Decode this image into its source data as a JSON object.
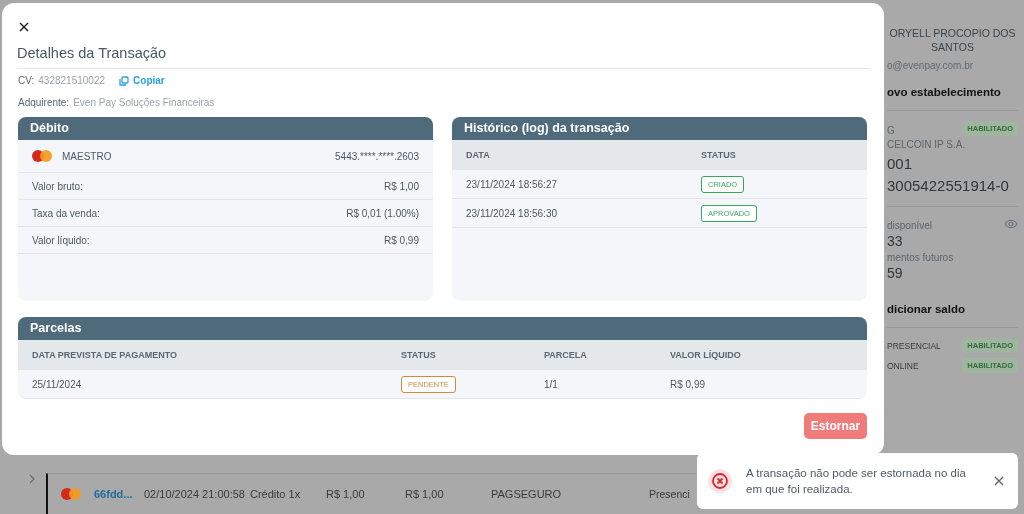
{
  "background_page": {
    "profile": {
      "name": "ORYELL PROCOPIO DOS SANTOS",
      "email": "o@evenpay.com.br",
      "new_store_link": "ovo estabelecimento",
      "account_label": "G",
      "account_badge": "HABILITADO",
      "bank": "CELCOIN IP S.A.",
      "agency": "001",
      "account_number": "3005422551914-0",
      "balance_label": "disponível",
      "balance_value": "33",
      "future_label": "mentos futuros",
      "future_value": "59",
      "add_balance_link": "dicionar saldo",
      "channels": [
        {
          "label": "PRESENCIAL",
          "badge": "HABILITADO"
        },
        {
          "label": "ONLINE",
          "badge": "HABILITADO"
        }
      ]
    },
    "table_row": {
      "id": "66fdd...",
      "date": "02/10/2024 21:00:58",
      "type": "Crédito 1x",
      "gross": "R$ 1,00",
      "net": "R$ 1,00",
      "acquirer": "PAGSEGURO",
      "channel": "Presenci"
    }
  },
  "modal": {
    "title": "Detalhes da Transação",
    "cv_label": "CV:",
    "cv_value": "432821510022",
    "copy_link": "Copiar",
    "acquirer_label": "Adquirente:",
    "acquirer_value": "Even Pay Soluções Financeiras",
    "debit": {
      "title": "Débito",
      "brand": "MAESTRO",
      "card_number": "5443.****.****.2603",
      "rows": [
        {
          "label": "Valor bruto:",
          "value": "R$ 1,00"
        },
        {
          "label": "Taxa da venda:",
          "value": "R$ 0,01 (1.00%)"
        },
        {
          "label": "Valor líquido:",
          "value": "R$ 0,99"
        }
      ]
    },
    "history": {
      "title": "Histórico (log) da transação",
      "columns": [
        "DATA",
        "STATUS"
      ],
      "rows": [
        {
          "date": "23/11/2024 18:56:27",
          "status": "CRIADO",
          "color": "#3aa55d"
        },
        {
          "date": "23/11/2024 18:56:30",
          "status": "APROVADO",
          "color": "#3aa55d"
        }
      ]
    },
    "installments": {
      "title": "Parcelas",
      "columns": [
        "DATA PREVISTA DE PAGAMENTO",
        "STATUS",
        "PARCELA",
        "VALOR LÍQUIDO"
      ],
      "rows": [
        {
          "date": "25/11/2024",
          "status": "PENDENTE",
          "color": "#d08a3a",
          "installment": "1/1",
          "net": "R$ 0,99"
        }
      ]
    },
    "refund_button": "Estornar"
  },
  "toast": {
    "message": "A transação não pode ser estornada no dia em que foi realizada."
  }
}
